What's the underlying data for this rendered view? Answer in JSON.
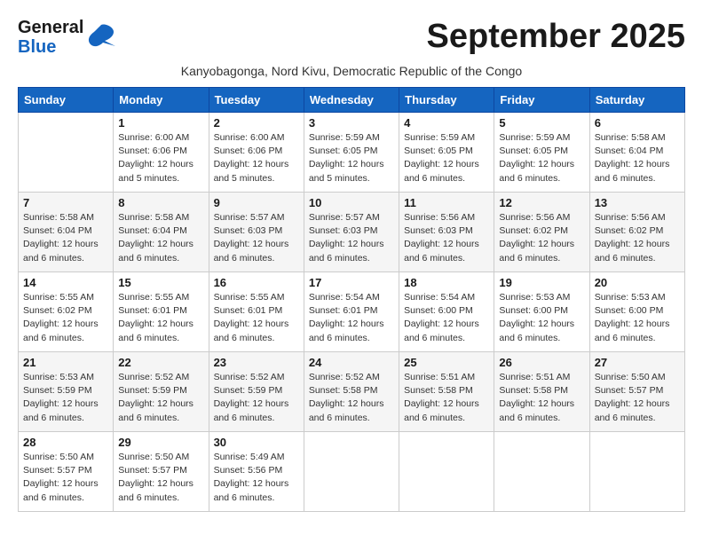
{
  "header": {
    "logo_line1": "General",
    "logo_line2": "Blue",
    "month_title": "September 2025",
    "subtitle": "Kanyobagonga, Nord Kivu, Democratic Republic of the Congo"
  },
  "days_of_week": [
    "Sunday",
    "Monday",
    "Tuesday",
    "Wednesday",
    "Thursday",
    "Friday",
    "Saturday"
  ],
  "weeks": [
    [
      {
        "day": "",
        "info": ""
      },
      {
        "day": "1",
        "info": "Sunrise: 6:00 AM\nSunset: 6:06 PM\nDaylight: 12 hours\nand 5 minutes."
      },
      {
        "day": "2",
        "info": "Sunrise: 6:00 AM\nSunset: 6:06 PM\nDaylight: 12 hours\nand 5 minutes."
      },
      {
        "day": "3",
        "info": "Sunrise: 5:59 AM\nSunset: 6:05 PM\nDaylight: 12 hours\nand 5 minutes."
      },
      {
        "day": "4",
        "info": "Sunrise: 5:59 AM\nSunset: 6:05 PM\nDaylight: 12 hours\nand 6 minutes."
      },
      {
        "day": "5",
        "info": "Sunrise: 5:59 AM\nSunset: 6:05 PM\nDaylight: 12 hours\nand 6 minutes."
      },
      {
        "day": "6",
        "info": "Sunrise: 5:58 AM\nSunset: 6:04 PM\nDaylight: 12 hours\nand 6 minutes."
      }
    ],
    [
      {
        "day": "7",
        "info": "Sunrise: 5:58 AM\nSunset: 6:04 PM\nDaylight: 12 hours\nand 6 minutes."
      },
      {
        "day": "8",
        "info": "Sunrise: 5:58 AM\nSunset: 6:04 PM\nDaylight: 12 hours\nand 6 minutes."
      },
      {
        "day": "9",
        "info": "Sunrise: 5:57 AM\nSunset: 6:03 PM\nDaylight: 12 hours\nand 6 minutes."
      },
      {
        "day": "10",
        "info": "Sunrise: 5:57 AM\nSunset: 6:03 PM\nDaylight: 12 hours\nand 6 minutes."
      },
      {
        "day": "11",
        "info": "Sunrise: 5:56 AM\nSunset: 6:03 PM\nDaylight: 12 hours\nand 6 minutes."
      },
      {
        "day": "12",
        "info": "Sunrise: 5:56 AM\nSunset: 6:02 PM\nDaylight: 12 hours\nand 6 minutes."
      },
      {
        "day": "13",
        "info": "Sunrise: 5:56 AM\nSunset: 6:02 PM\nDaylight: 12 hours\nand 6 minutes."
      }
    ],
    [
      {
        "day": "14",
        "info": "Sunrise: 5:55 AM\nSunset: 6:02 PM\nDaylight: 12 hours\nand 6 minutes."
      },
      {
        "day": "15",
        "info": "Sunrise: 5:55 AM\nSunset: 6:01 PM\nDaylight: 12 hours\nand 6 minutes."
      },
      {
        "day": "16",
        "info": "Sunrise: 5:55 AM\nSunset: 6:01 PM\nDaylight: 12 hours\nand 6 minutes."
      },
      {
        "day": "17",
        "info": "Sunrise: 5:54 AM\nSunset: 6:01 PM\nDaylight: 12 hours\nand 6 minutes."
      },
      {
        "day": "18",
        "info": "Sunrise: 5:54 AM\nSunset: 6:00 PM\nDaylight: 12 hours\nand 6 minutes."
      },
      {
        "day": "19",
        "info": "Sunrise: 5:53 AM\nSunset: 6:00 PM\nDaylight: 12 hours\nand 6 minutes."
      },
      {
        "day": "20",
        "info": "Sunrise: 5:53 AM\nSunset: 6:00 PM\nDaylight: 12 hours\nand 6 minutes."
      }
    ],
    [
      {
        "day": "21",
        "info": "Sunrise: 5:53 AM\nSunset: 5:59 PM\nDaylight: 12 hours\nand 6 minutes."
      },
      {
        "day": "22",
        "info": "Sunrise: 5:52 AM\nSunset: 5:59 PM\nDaylight: 12 hours\nand 6 minutes."
      },
      {
        "day": "23",
        "info": "Sunrise: 5:52 AM\nSunset: 5:59 PM\nDaylight: 12 hours\nand 6 minutes."
      },
      {
        "day": "24",
        "info": "Sunrise: 5:52 AM\nSunset: 5:58 PM\nDaylight: 12 hours\nand 6 minutes."
      },
      {
        "day": "25",
        "info": "Sunrise: 5:51 AM\nSunset: 5:58 PM\nDaylight: 12 hours\nand 6 minutes."
      },
      {
        "day": "26",
        "info": "Sunrise: 5:51 AM\nSunset: 5:58 PM\nDaylight: 12 hours\nand 6 minutes."
      },
      {
        "day": "27",
        "info": "Sunrise: 5:50 AM\nSunset: 5:57 PM\nDaylight: 12 hours\nand 6 minutes."
      }
    ],
    [
      {
        "day": "28",
        "info": "Sunrise: 5:50 AM\nSunset: 5:57 PM\nDaylight: 12 hours\nand 6 minutes."
      },
      {
        "day": "29",
        "info": "Sunrise: 5:50 AM\nSunset: 5:57 PM\nDaylight: 12 hours\nand 6 minutes."
      },
      {
        "day": "30",
        "info": "Sunrise: 5:49 AM\nSunset: 5:56 PM\nDaylight: 12 hours\nand 6 minutes."
      },
      {
        "day": "",
        "info": ""
      },
      {
        "day": "",
        "info": ""
      },
      {
        "day": "",
        "info": ""
      },
      {
        "day": "",
        "info": ""
      }
    ]
  ]
}
